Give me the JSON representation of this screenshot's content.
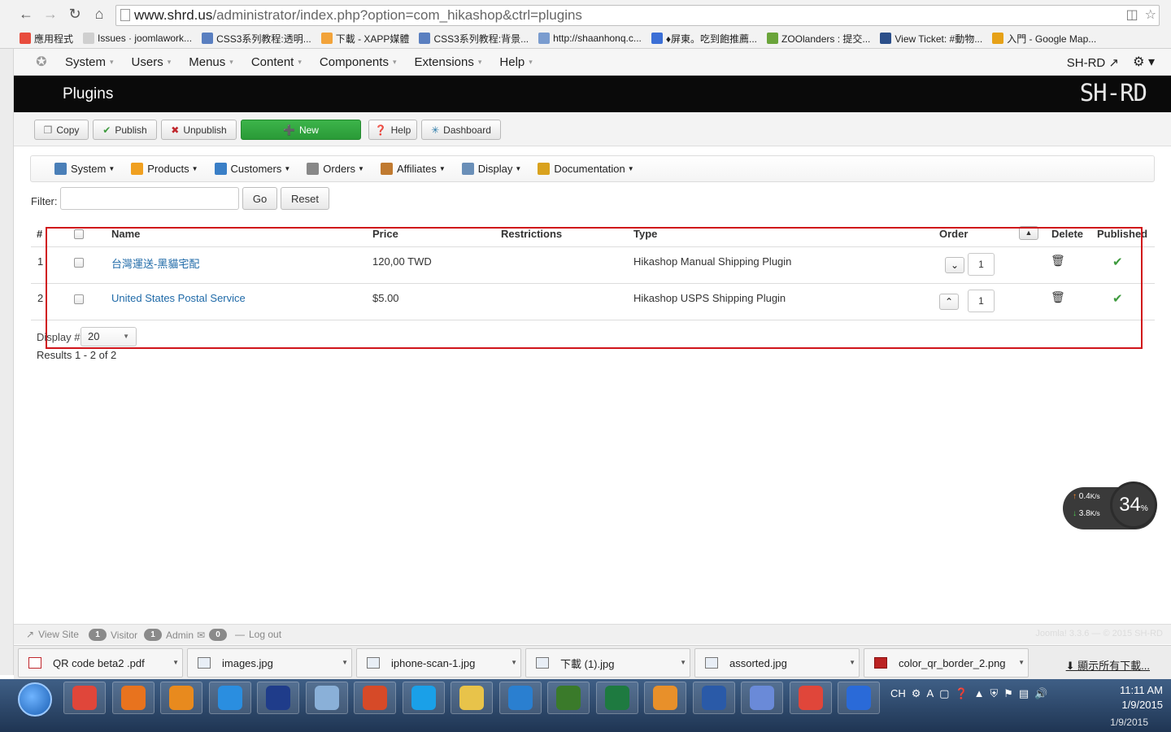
{
  "browser": {
    "url_host": "www.shrd.us",
    "url_path": "/administrator/index.php?option=com_hikashop&ctrl=plugins",
    "bookmarks": [
      {
        "label": "應用程式",
        "color": "#e84c3d"
      },
      {
        "label": "Issues · joomlawork...",
        "color": "#cfcfcf"
      },
      {
        "label": "CSS3系列教程:透明...",
        "color": "#5a7fc0"
      },
      {
        "label": "下載 - XAPP媒體",
        "color": "#f2a33a"
      },
      {
        "label": "CSS3系列教程:背景...",
        "color": "#5a7fc0"
      },
      {
        "label": "http://shaanhonq.c...",
        "color": "#7a9ccf"
      },
      {
        "label": "♦屏東。吃到飽推薦...",
        "color": "#3b6fd6"
      },
      {
        "label": "ZOOlanders : 提交...",
        "color": "#6aa43a"
      },
      {
        "label": "View Ticket: #動物...",
        "color": "#2b4f8a"
      },
      {
        "label": "入門 - Google Map...",
        "color": "#e6a117"
      }
    ]
  },
  "topmenu": {
    "items": [
      "System",
      "Users",
      "Menus",
      "Content",
      "Components",
      "Extensions",
      "Help"
    ],
    "site_link": "SH-RD"
  },
  "header": {
    "title": "Plugins",
    "brand": "SH-RD"
  },
  "toolbar": {
    "copy": "Copy",
    "publish": "Publish",
    "unpublish": "Unpublish",
    "new": "New",
    "help": "Help",
    "dashboard": "Dashboard"
  },
  "subnav": {
    "items": [
      "System",
      "Products",
      "Customers",
      "Orders",
      "Affiliates",
      "Display",
      "Documentation"
    ]
  },
  "filter": {
    "label": "Filter:",
    "value": "",
    "go": "Go",
    "reset": "Reset"
  },
  "table": {
    "columns": {
      "num": "#",
      "name": "Name",
      "price": "Price",
      "restrictions": "Restrictions",
      "type": "Type",
      "order": "Order",
      "delete": "Delete",
      "published": "Published"
    },
    "rows": [
      {
        "num": "1",
        "name": "台灣運送-黑貓宅配",
        "price": "120,00 TWD",
        "restrictions": "",
        "type": "Hikashop Manual Shipping Plugin",
        "order": "1",
        "published": true
      },
      {
        "num": "2",
        "name": "United States Postal Service",
        "price": "$5.00",
        "restrictions": "",
        "type": "Hikashop USPS Shipping Plugin",
        "order": "1",
        "published": true
      }
    ]
  },
  "pagination": {
    "display_label": "Display #",
    "display_value": "20",
    "results": "Results 1 - 2 of 2"
  },
  "speed_widget": {
    "up": "0.4",
    "down": "3.8",
    "unit": "K/s",
    "percent": "34"
  },
  "statusbar": {
    "view_site": "View Site",
    "visitor_count": "1",
    "visitor_label": "Visitor",
    "admin_count": "1",
    "admin_label": "Admin",
    "messages_count": "0",
    "logout": "Log out",
    "copyright": "Joomla! 3.3.6 — © 2015 SH-RD"
  },
  "downloads": {
    "items": [
      {
        "name": "QR code beta2 .pdf",
        "type": "pdf"
      },
      {
        "name": "images.jpg",
        "type": "jpg"
      },
      {
        "name": "iphone-scan-1.jpg",
        "type": "jpg"
      },
      {
        "name": "下載 (1).jpg",
        "type": "jpg"
      },
      {
        "name": "assorted.jpg",
        "type": "jpg"
      },
      {
        "name": "color_qr_border_2.png",
        "type": "png"
      }
    ],
    "show_all": "顯示所有下載..."
  },
  "taskbar": {
    "apps": [
      "Chrome",
      "Firefox",
      "Media",
      "IE",
      "Ps",
      "Notes",
      "PowerPoint",
      "Skype",
      "Explorer",
      "Browser",
      "Dw",
      "Excel",
      "Outlook",
      "Word",
      "iTunes",
      "Chrome",
      "Shield"
    ],
    "tray_lang": "CH",
    "time": "11:11 AM",
    "date": "1/9/2015"
  },
  "colors": {
    "header_bg": "#0a0a0a",
    "new_button": "#2fa53c",
    "link": "#1f6aa8",
    "highlight_box": "#d0141a",
    "published_check": "#3d9a3d"
  }
}
